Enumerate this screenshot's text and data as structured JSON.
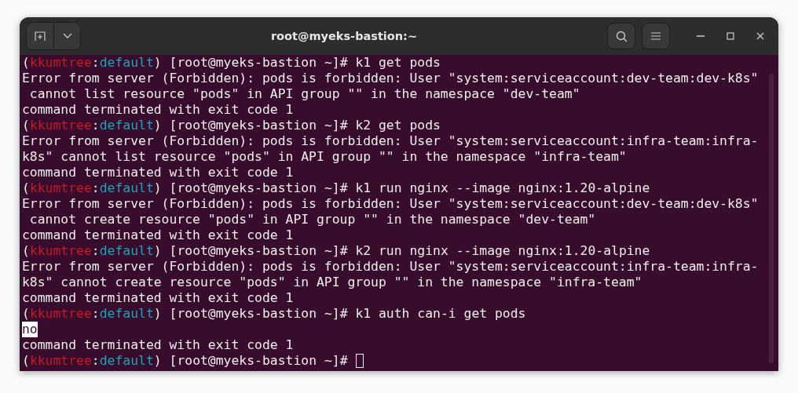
{
  "window": {
    "title": "root@myeks-bastion:~"
  },
  "lines": [
    {
      "kind": "prompt",
      "open": "(",
      "context": "kkumtree",
      "sep": ":",
      "namespace": "default",
      "close": ")",
      "host": "[root@myeks-bastion ~]#",
      "command": "k1 get pods"
    },
    {
      "kind": "output",
      "text": "Error from server (Forbidden): pods is forbidden: User \"system:serviceaccount:dev-team:dev-k8s\""
    },
    {
      "kind": "output",
      "text": " cannot list resource \"pods\" in API group \"\" in the namespace \"dev-team\""
    },
    {
      "kind": "output",
      "text": "command terminated with exit code 1"
    },
    {
      "kind": "prompt",
      "open": "(",
      "context": "kkumtree",
      "sep": ":",
      "namespace": "default",
      "close": ")",
      "host": "[root@myeks-bastion ~]#",
      "command": "k2 get pods"
    },
    {
      "kind": "output",
      "text": "Error from server (Forbidden): pods is forbidden: User \"system:serviceaccount:infra-team:infra-"
    },
    {
      "kind": "output",
      "text": "k8s\" cannot list resource \"pods\" in API group \"\" in the namespace \"infra-team\""
    },
    {
      "kind": "output",
      "text": "command terminated with exit code 1"
    },
    {
      "kind": "prompt",
      "open": "(",
      "context": "kkumtree",
      "sep": ":",
      "namespace": "default",
      "close": ")",
      "host": "[root@myeks-bastion ~]#",
      "command": "k1 run nginx --image nginx:1.20-alpine"
    },
    {
      "kind": "output",
      "text": "Error from server (Forbidden): pods is forbidden: User \"system:serviceaccount:dev-team:dev-k8s\""
    },
    {
      "kind": "output",
      "text": " cannot create resource \"pods\" in API group \"\" in the namespace \"dev-team\""
    },
    {
      "kind": "output",
      "text": "command terminated with exit code 1"
    },
    {
      "kind": "prompt",
      "open": "(",
      "context": "kkumtree",
      "sep": ":",
      "namespace": "default",
      "close": ")",
      "host": "[root@myeks-bastion ~]#",
      "command": "k2 run nginx --image nginx:1.20-alpine"
    },
    {
      "kind": "output",
      "text": "Error from server (Forbidden): pods is forbidden: User \"system:serviceaccount:infra-team:infra-"
    },
    {
      "kind": "output",
      "text": "k8s\" cannot create resource \"pods\" in API group \"\" in the namespace \"infra-team\""
    },
    {
      "kind": "output",
      "text": "command terminated with exit code 1"
    },
    {
      "kind": "prompt",
      "open": "(",
      "context": "kkumtree",
      "sep": ":",
      "namespace": "default",
      "close": ")",
      "host": "[root@myeks-bastion ~]#",
      "command": "k1 auth can-i get pods"
    },
    {
      "kind": "highlight",
      "text": "no"
    },
    {
      "kind": "output",
      "text": "command terminated with exit code 1"
    },
    {
      "kind": "prompt",
      "open": "(",
      "context": "kkumtree",
      "sep": ":",
      "namespace": "default",
      "close": ")",
      "host": "[root@myeks-bastion ~]#",
      "cursor": true
    }
  ]
}
